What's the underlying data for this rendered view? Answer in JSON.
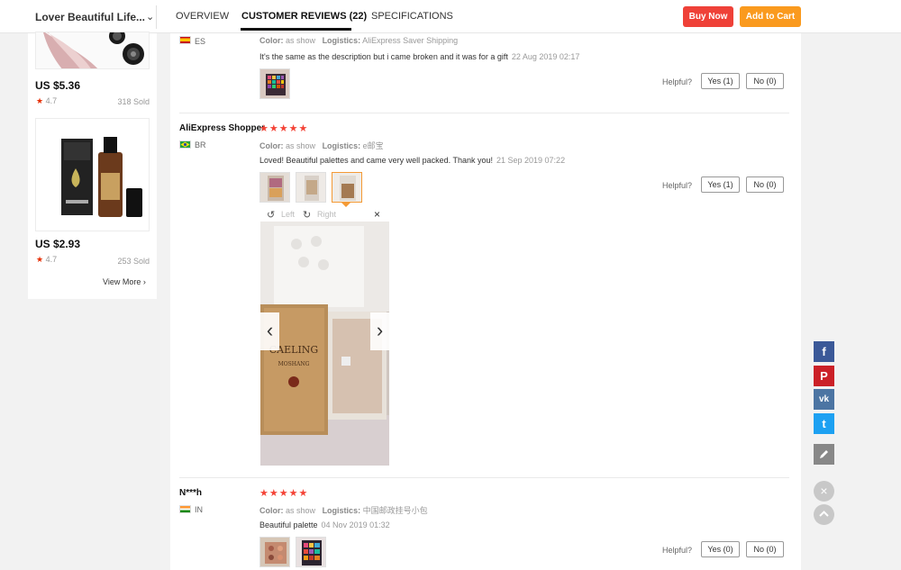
{
  "header": {
    "store_name": "Lover Beautiful Life...",
    "tabs": [
      "OVERVIEW",
      "CUSTOMER REVIEWS (22)",
      "SPECIFICATIONS"
    ],
    "buy_now": "Buy Now",
    "add_to_cart": "Add to Cart"
  },
  "sidebar": {
    "products": [
      {
        "price": "US $5.36",
        "rating": "4.7",
        "sold": "318 Sold"
      },
      {
        "price": "US $2.93",
        "rating": "4.7",
        "sold": "253 Sold"
      }
    ],
    "view_more": "View More"
  },
  "reviews": [
    {
      "reviewer": "",
      "country": "ES",
      "color_label": "Color:",
      "color_value": "as show",
      "logistics_label": "Logistics:",
      "logistics_value": "AliExpress Saver Shipping",
      "comment": "It's the same as the description but i came broken and it was for a gift",
      "date": "22 Aug 2019 02:17",
      "helpful": "Helpful?",
      "yes": "Yes (1)",
      "no": "No (0)"
    },
    {
      "reviewer": "AliExpress Shopper",
      "stars": "★★★★★",
      "country": "BR",
      "color_label": "Color:",
      "color_value": "as show",
      "logistics_label": "Logistics:",
      "logistics_value": "e邮宝",
      "comment": "Loved! Beautiful palettes and came very well packed. Thank you!",
      "date": "21 Sep 2019 07:22",
      "helpful": "Helpful?",
      "yes": "Yes (1)",
      "no": "No (0)"
    },
    {
      "reviewer": "N***h",
      "stars": "★★★★★",
      "country": "IN",
      "color_label": "Color:",
      "color_value": "as show",
      "logistics_label": "Logistics:",
      "logistics_value": "中国邮政挂号小包",
      "comment": "Beautiful palette",
      "date": "04 Nov 2019 01:32",
      "helpful": "Helpful?",
      "yes": "Yes (0)",
      "no": "No (0)"
    }
  ],
  "viewer": {
    "left": "Left",
    "right": "Right",
    "close": "×",
    "product_text": "CAELING",
    "product_subtext": "MOSHANG"
  },
  "social": {
    "facebook": "f",
    "pinterest": "P",
    "vk": "vk",
    "twitter": "t"
  },
  "colors": {
    "buy_now": "#ef4138",
    "add_to_cart": "#fa9a1e",
    "star": "#f44336",
    "facebook": "#3b5998",
    "pinterest": "#cb2027",
    "vk": "#4c75a3",
    "twitter": "#1da1f2"
  }
}
